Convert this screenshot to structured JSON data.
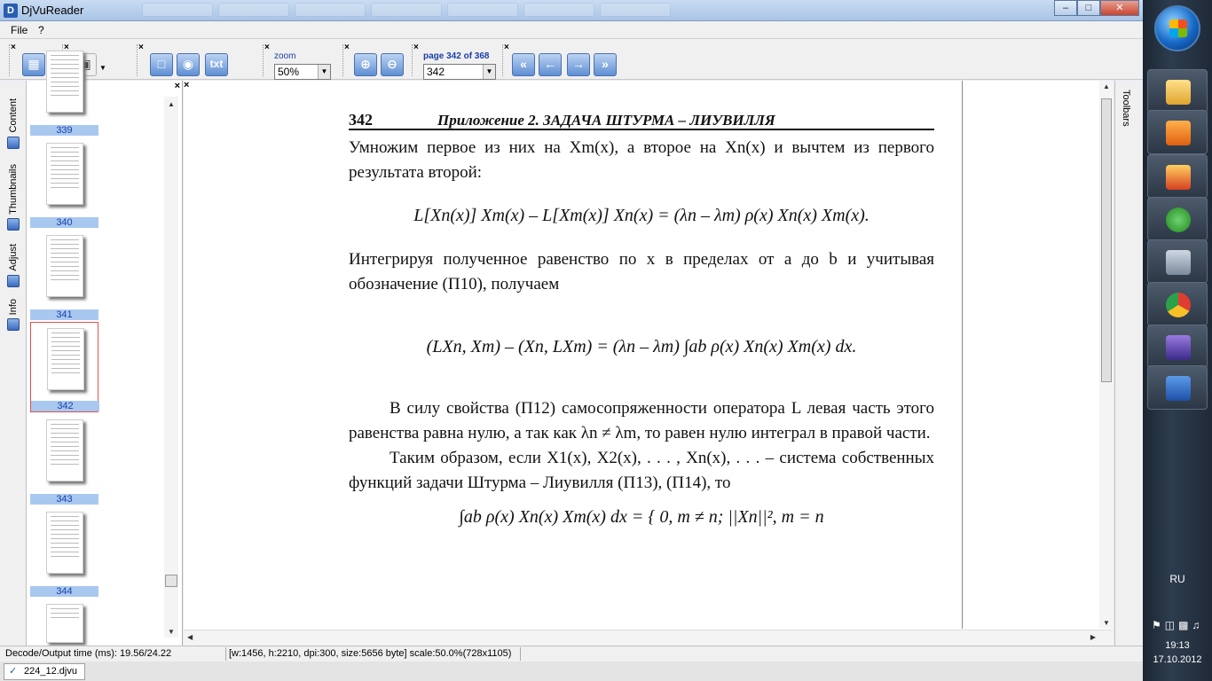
{
  "window": {
    "title": "DjVuReader"
  },
  "menu": {
    "file": "File",
    "help": "?"
  },
  "toolbar": {
    "zoom_label": "zoom",
    "zoom_value": "50%",
    "page_label": "page 342 of 368",
    "page_value": "342",
    "txt_label": "txt"
  },
  "sidetabs": [
    "Content",
    "Thumbnails",
    "Adjust",
    "Info"
  ],
  "thumbnails": [
    "339",
    "340",
    "341",
    "342",
    "343",
    "344"
  ],
  "selected_thumbnail": "342",
  "document": {
    "page_number": "342",
    "running_title": "Приложение 2. ЗАДАЧА ШТУРМА – ЛИУВИЛЛЯ",
    "p1": "Умножим первое из них на Xm(x), а второе на Xn(x) и вычтем из первого результата второй:",
    "formula1": "L[Xn(x)] Xm(x) – L[Xm(x)] Xn(x) = (λn – λm) ρ(x) Xn(x) Xm(x).",
    "p2": "Интегрируя полученное равенство по x в пределах от a до b и учитывая обозначение (П10), получаем",
    "formula2": "(LXn, Xm) – (Xn, LXm) = (λn – λm) ∫ab ρ(x) Xn(x) Xm(x) dx.",
    "p3": "В силу свойства (П12) самосопряженности оператора L левая часть этого равенства равна нулю, а так как λn ≠ λm, то равен нулю интеграл в правой части.",
    "p4": "Таким образом, если X1(x), X2(x), . . . , Xn(x), . . . – система собственных функций задачи Штурма – Лиувилля (П13), (П14), то",
    "formula3": "∫ab ρ(x) Xn(x) Xm(x) dx = { 0,  m ≠ n;  ||Xn||²,  m = n"
  },
  "toolstrip_label": "Toolbars",
  "status": {
    "timing": "Decode/Output time (ms): 19.56/24.22",
    "info": "[w:1456, h:2210, dpi:300, size:5656 byte] scale:50.0%(728x1105)"
  },
  "file_tab": "224_12.djvu",
  "taskbar": {
    "lang": "RU",
    "time": "19:13",
    "date": "17.10.2012"
  },
  "colors": {
    "accent": "#1a3fa8",
    "thumb_label_bg": "#a8c8f0",
    "selection": "#e05050"
  }
}
